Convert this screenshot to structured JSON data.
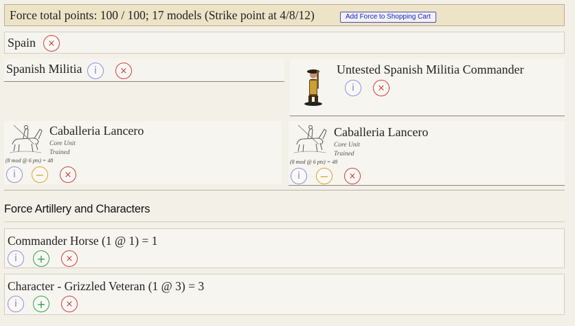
{
  "header": {
    "summary": "Force total points: 100 / 100; 17 models (Strike point at 4/8/12)",
    "cart_button": "Add Force to Shopping Cart"
  },
  "faction": {
    "name": "Spain"
  },
  "unit_group": {
    "name": "Spanish Militia"
  },
  "commander": {
    "name": "Untested Spanish Militia Commander"
  },
  "units": [
    {
      "name": "Caballeria Lancero",
      "type": "Core Unit",
      "quality": "Trained",
      "cost_line": "(8 mod @ 6 pts) = 48"
    },
    {
      "name": "Caballeria Lancero",
      "type": "Core Unit",
      "quality": "Trained",
      "cost_line": "(8 mod @ 6 pts) = 48"
    }
  ],
  "section": {
    "title": "Force Artillery and Characters"
  },
  "characters": [
    {
      "label": "Commander Horse (1 @ 1) = 1"
    },
    {
      "label": "Character - Grizzled Veteran (1 @ 3) = 3"
    }
  ],
  "icons": {
    "info": "info-icon",
    "remove": "remove-icon",
    "decrease": "minus-icon",
    "increase": "plus-icon"
  },
  "glyphs": {
    "info": "i",
    "remove": "×",
    "minus": "−",
    "plus": "+"
  },
  "colors": {
    "header_bg": "#ede3c6",
    "info": "#7a80d8",
    "remove": "#d43a3a",
    "decrease": "#e0a02a",
    "increase": "#2aa24a"
  }
}
